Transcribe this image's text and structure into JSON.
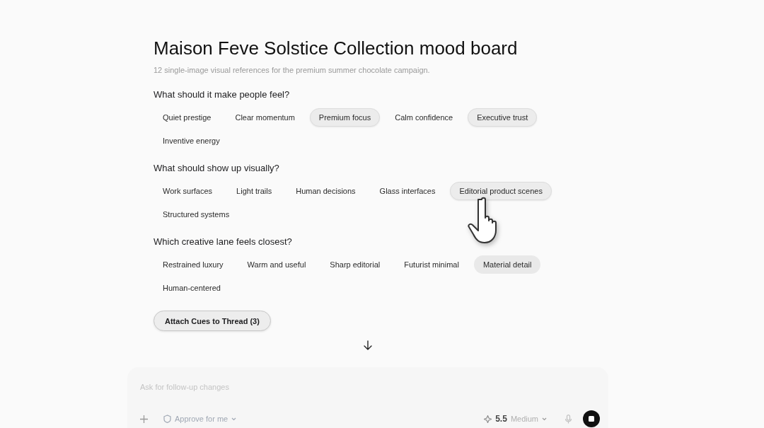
{
  "board": {
    "title": "Maison Feve Solstice Collection mood board",
    "subtitle": "12 single-image visual references for the premium summer chocolate campaign.",
    "questions": [
      {
        "label": "What should it make people feel?",
        "options": [
          {
            "label": "Quiet prestige",
            "selected": false,
            "hovered": false
          },
          {
            "label": "Clear momentum",
            "selected": false,
            "hovered": false
          },
          {
            "label": "Premium focus",
            "selected": true,
            "hovered": false
          },
          {
            "label": "Calm confidence",
            "selected": false,
            "hovered": false
          },
          {
            "label": "Executive trust",
            "selected": true,
            "hovered": false
          },
          {
            "label": "Inventive energy",
            "selected": false,
            "hovered": false
          }
        ]
      },
      {
        "label": "What should show up visually?",
        "options": [
          {
            "label": "Work surfaces",
            "selected": false,
            "hovered": false
          },
          {
            "label": "Light trails",
            "selected": false,
            "hovered": false
          },
          {
            "label": "Human decisions",
            "selected": false,
            "hovered": false
          },
          {
            "label": "Glass interfaces",
            "selected": false,
            "hovered": false
          },
          {
            "label": "Editorial product scenes",
            "selected": true,
            "hovered": false
          },
          {
            "label": "Structured systems",
            "selected": false,
            "hovered": false
          }
        ]
      },
      {
        "label": "Which creative lane feels closest?",
        "options": [
          {
            "label": "Restrained luxury",
            "selected": false,
            "hovered": false
          },
          {
            "label": "Warm and useful",
            "selected": false,
            "hovered": false
          },
          {
            "label": "Sharp editorial",
            "selected": false,
            "hovered": false
          },
          {
            "label": "Futurist minimal",
            "selected": false,
            "hovered": false
          },
          {
            "label": "Material detail",
            "selected": false,
            "hovered": true
          },
          {
            "label": "Human-centered",
            "selected": false,
            "hovered": false
          }
        ]
      }
    ],
    "attach_button": "Attach Cues to Thread (3)"
  },
  "composer": {
    "placeholder": "Ask for follow-up changes",
    "approval": "Approve for me",
    "model": "5.5",
    "effort": "Medium",
    "running": true
  }
}
